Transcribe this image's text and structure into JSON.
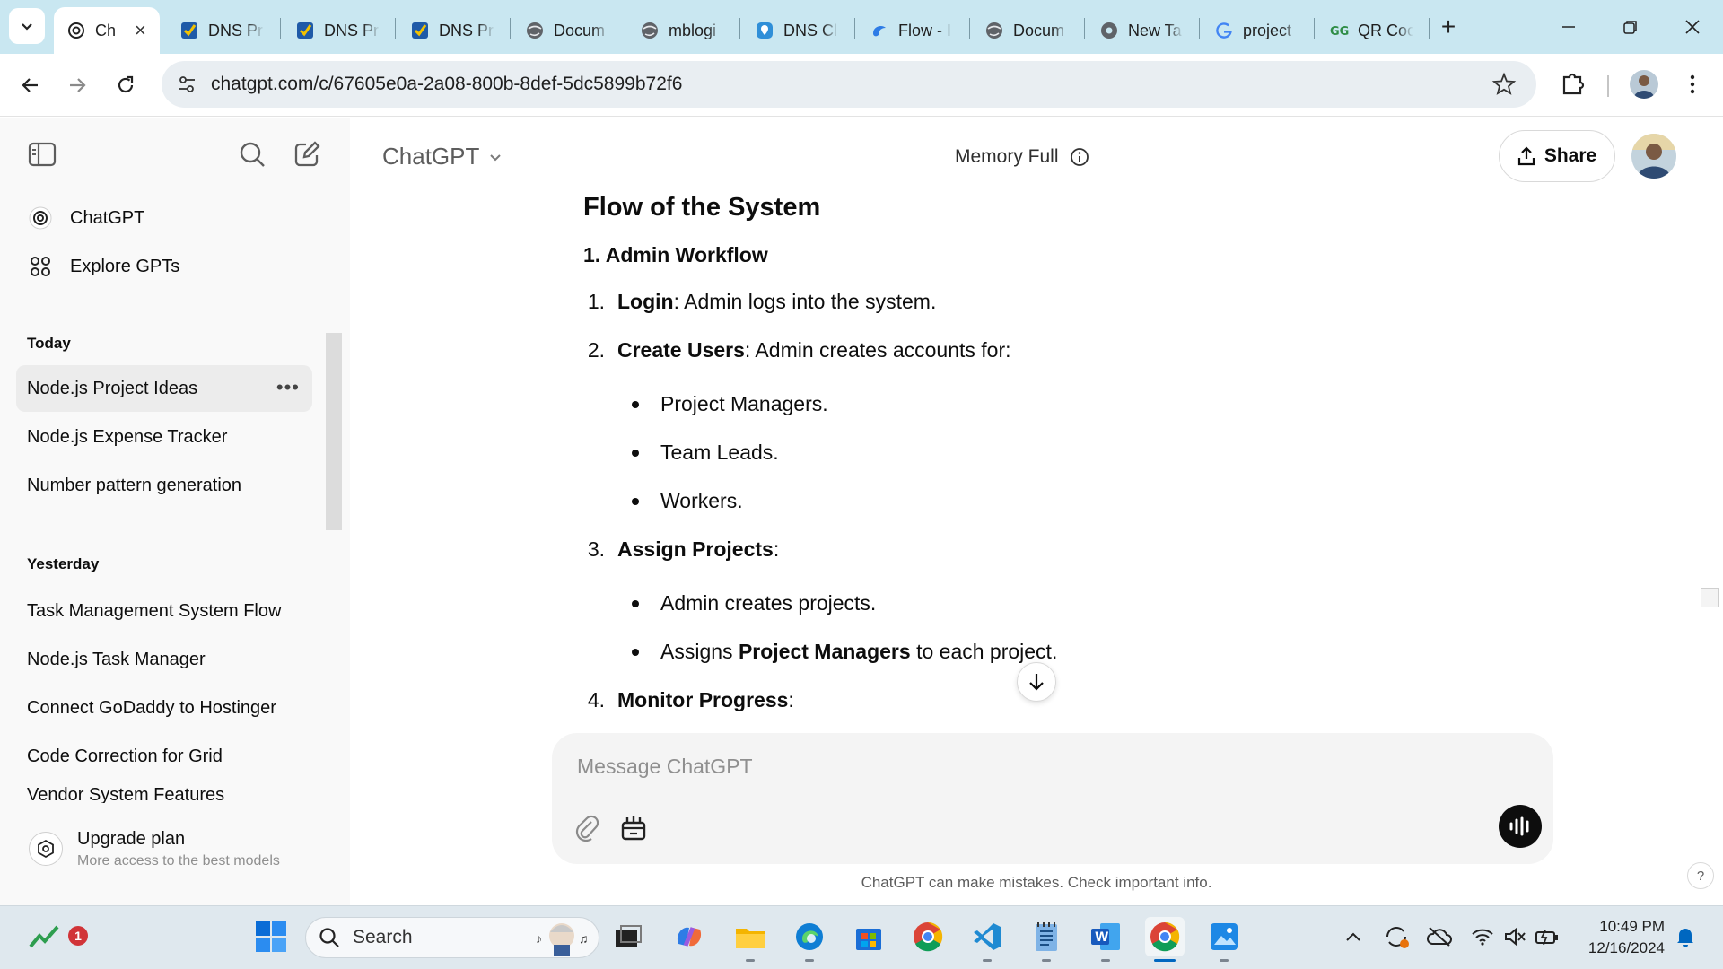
{
  "browser": {
    "tabs": [
      {
        "label": "Ch",
        "icon": "openai-icon",
        "active": true
      },
      {
        "label": "DNS Pr",
        "icon": "checkmark-shield-icon"
      },
      {
        "label": "DNS Pr",
        "icon": "checkmark-shield-icon"
      },
      {
        "label": "DNS Pr",
        "icon": "checkmark-shield-icon"
      },
      {
        "label": "Docum",
        "icon": "globe-icon"
      },
      {
        "label": "mblogi",
        "icon": "globe-icon"
      },
      {
        "label": "DNS Cl",
        "icon": "location-pin-icon"
      },
      {
        "label": "Flow - I",
        "icon": "flow-icon"
      },
      {
        "label": "Docum",
        "icon": "globe-icon"
      },
      {
        "label": "New Ta",
        "icon": "chrome-icon"
      },
      {
        "label": "project",
        "icon": "google-icon"
      },
      {
        "label": "QR Coc",
        "icon": "geeks-icon"
      }
    ],
    "url": "chatgpt.com/c/67605e0a-2a08-800b-8def-5dc5899b72f6",
    "tab_close": "×",
    "new_tab": "+"
  },
  "sidebar": {
    "nav": [
      {
        "label": "ChatGPT",
        "icon": "openai-icon"
      },
      {
        "label": "Explore GPTs",
        "icon": "grid-icon"
      }
    ],
    "sections": [
      {
        "title": "Today",
        "items": [
          "Node.js Project Ideas",
          "Node.js Expense Tracker",
          "Number pattern generation"
        ]
      },
      {
        "title": "Yesterday",
        "items": [
          "Task Management System Flow",
          "Node.js Task Manager",
          "Connect GoDaddy to Hostinger",
          "Code Correction for Grid",
          "Vendor System Features"
        ]
      }
    ],
    "active_more": "•••",
    "upgrade": {
      "title": "Upgrade plan",
      "subtitle": "More access to the best models"
    }
  },
  "header": {
    "model": "ChatGPT",
    "memory": "Memory Full",
    "share": "Share"
  },
  "message": {
    "heading": "Flow of the System",
    "subheading": "1. Admin Workflow",
    "steps": [
      {
        "num": "1.",
        "bold": "Login",
        "rest": ": Admin logs into the system."
      },
      {
        "num": "2.",
        "bold": "Create Users",
        "rest": ": Admin creates accounts for:"
      },
      {
        "num": "3.",
        "bold": "Assign Projects",
        "rest": ":"
      },
      {
        "num": "4.",
        "bold": "Monitor Progress",
        "rest": ":"
      }
    ],
    "bullets_step2": [
      "Project Managers.",
      "Team Leads.",
      "Workers."
    ],
    "bullets_step3": [
      {
        "text": "Admin creates projects."
      },
      {
        "pre": "Assigns ",
        "bold": "Project Managers",
        "post": " to each project."
      }
    ]
  },
  "composer": {
    "placeholder": "Message ChatGPT",
    "disclaimer": "ChatGPT can make mistakes. Check important info.",
    "help": "?"
  },
  "taskbar": {
    "search": "Search",
    "notification_badge": "1",
    "time": "10:49 PM",
    "date": "12/16/2024"
  },
  "colors": {
    "tabstrip": "#c9e7f1",
    "sidebar": "#f9f9f9",
    "composer": "#f4f4f4",
    "taskbar": "#dfe8ee",
    "accent": "#0067c0"
  }
}
